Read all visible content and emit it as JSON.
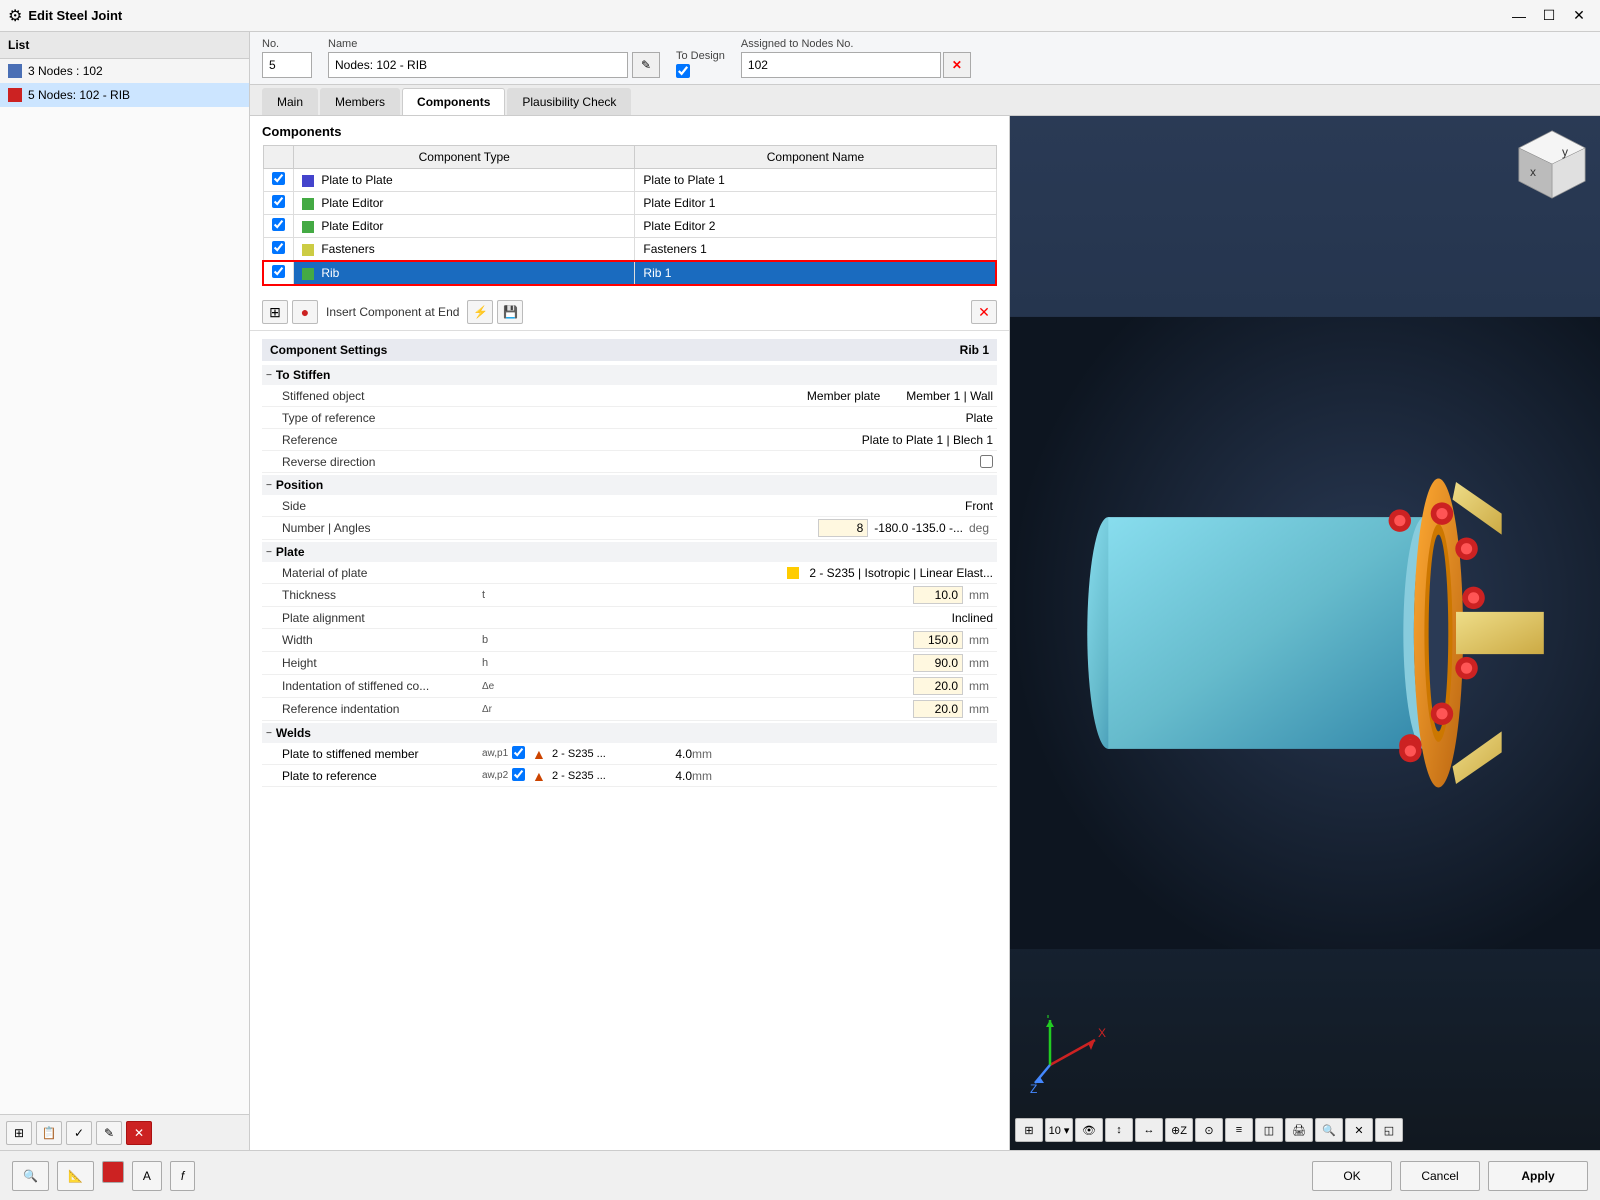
{
  "titlebar": {
    "icon": "⚙",
    "title": "Edit Steel Joint",
    "minimize": "—",
    "maximize": "☐",
    "close": "✕"
  },
  "left_panel": {
    "header": "List",
    "items": [
      {
        "label": "3 Nodes : 102",
        "color": "#4a6fb5",
        "selected": false
      },
      {
        "label": "5 Nodes: 102 - RIB",
        "color": "#cc2222",
        "selected": true
      }
    ]
  },
  "top_form": {
    "no_label": "No.",
    "no_value": "5",
    "name_label": "Name",
    "name_value": "Nodes: 102 - RIB",
    "to_design_label": "To Design",
    "to_design_checked": true,
    "assigned_label": "Assigned to Nodes No.",
    "assigned_value": "102"
  },
  "tabs": [
    {
      "label": "Main",
      "active": false
    },
    {
      "label": "Members",
      "active": false
    },
    {
      "label": "Components",
      "active": true
    },
    {
      "label": "Plausibility Check",
      "active": false
    }
  ],
  "components": {
    "title": "Components",
    "col_type": "Component Type",
    "col_name": "Component Name",
    "rows": [
      {
        "checked": true,
        "color": "#4444cc",
        "type": "Plate to Plate",
        "name": "Plate to Plate 1",
        "selected": false,
        "red_border": false
      },
      {
        "checked": true,
        "color": "#44aa44",
        "type": "Plate Editor",
        "name": "Plate Editor 1",
        "selected": false,
        "red_border": false
      },
      {
        "checked": true,
        "color": "#44aa44",
        "type": "Plate Editor",
        "name": "Plate Editor 2",
        "selected": false,
        "red_border": false
      },
      {
        "checked": true,
        "color": "#cccc44",
        "type": "Fasteners",
        "name": "Fasteners 1",
        "selected": false,
        "red_border": false
      },
      {
        "checked": true,
        "color": "#44aa44",
        "type": "Rib",
        "name": "Rib 1",
        "selected": true,
        "red_border": true
      }
    ]
  },
  "comp_toolbar": {
    "btn1": "⊞",
    "btn2": "⊟",
    "insert_label": "Insert Component at End",
    "btn3": "⚡",
    "btn4": "💾",
    "btn_delete": "✕"
  },
  "comp_settings": {
    "title": "Component Settings",
    "subtitle": "Rib 1",
    "groups": [
      {
        "name": "To Stiffen",
        "rows": [
          {
            "label": "Stiffened object",
            "symbol": "",
            "value": "Member plate",
            "extra": "Member 1 | Wall"
          },
          {
            "label": "Type of reference",
            "symbol": "",
            "value": "Plate",
            "extra": ""
          },
          {
            "label": "Reference",
            "symbol": "",
            "value": "Plate to Plate 1 | Blech 1",
            "extra": ""
          },
          {
            "label": "Reverse direction",
            "symbol": "",
            "value": "checkbox",
            "extra": ""
          }
        ]
      },
      {
        "name": "Position",
        "rows": [
          {
            "label": "Side",
            "symbol": "",
            "value": "Front",
            "extra": ""
          },
          {
            "label": "Number | Angles",
            "symbol": "",
            "value": "8",
            "extra": "-180.0  -135.0 -…  deg"
          }
        ]
      },
      {
        "name": "Plate",
        "rows": [
          {
            "label": "Material of plate",
            "symbol": "",
            "value": "🟡 2 - S235 | Isotropic | Linear Elast...",
            "extra": ""
          },
          {
            "label": "Thickness",
            "symbol": "t",
            "value": "10.0",
            "unit": "mm",
            "extra": ""
          },
          {
            "label": "Plate alignment",
            "symbol": "",
            "value": "Inclined",
            "extra": ""
          },
          {
            "label": "Width",
            "symbol": "b",
            "value": "150.0",
            "unit": "mm",
            "extra": ""
          },
          {
            "label": "Height",
            "symbol": "h",
            "value": "90.0",
            "unit": "mm",
            "extra": ""
          },
          {
            "label": "Indentation of stiffened co...",
            "symbol": "Δe",
            "value": "20.0",
            "unit": "mm",
            "extra": ""
          },
          {
            "label": "Reference indentation",
            "symbol": "Δr",
            "value": "20.0",
            "unit": "mm",
            "extra": ""
          }
        ]
      },
      {
        "name": "Welds",
        "rows": [
          {
            "label": "Plate to stiffened member",
            "symbol": "aw,p1",
            "weld": true,
            "material": "2 - S235 ...",
            "value": "4.0",
            "unit": "mm"
          },
          {
            "label": "Plate to reference",
            "symbol": "aw,p2",
            "weld": true,
            "material": "2 - S235 ...",
            "value": "4.0",
            "unit": "mm"
          }
        ]
      }
    ]
  },
  "bottom_toolbar": {
    "icons": [
      "🔍",
      "📐",
      "🟥",
      "🔤",
      "𝑓"
    ],
    "ok": "OK",
    "cancel": "Cancel",
    "apply": "Apply"
  },
  "left_bottom_toolbar": {
    "btns": [
      "⊞",
      "📋",
      "✓",
      "✎",
      "✕"
    ]
  }
}
